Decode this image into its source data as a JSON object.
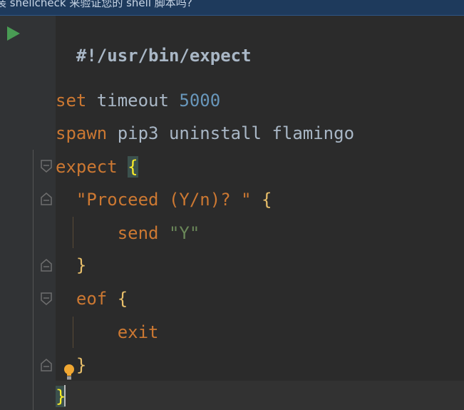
{
  "banner": {
    "text": "装 shellcheck 来验证您的 shell 脚本吗?"
  },
  "code": {
    "line1": {
      "text": "#!/usr/bin/expect"
    },
    "line3": {
      "kw": "set",
      "ident": " timeout ",
      "num": "5000"
    },
    "line4": {
      "kw": "spawn",
      "rest": " pip3 uninstall flamingo"
    },
    "line5": {
      "kw": "expect",
      "space": " ",
      "brace": "{"
    },
    "line6": {
      "indent": "  ",
      "str": "\"Proceed (Y/n)? \"",
      "space": " ",
      "brace": "{"
    },
    "line7": {
      "indent": "      ",
      "kw": "send",
      "space": " ",
      "str": "\"Y\""
    },
    "line8": {
      "indent": "  ",
      "brace": "}"
    },
    "line9": {
      "indent": "  ",
      "kw": "eof",
      "space": " ",
      "brace": "{"
    },
    "line10": {
      "indent": "      ",
      "kw": "exit"
    },
    "line11": {
      "indent": "  ",
      "brace": "}"
    },
    "line12": {
      "brace": "}"
    }
  },
  "colors": {
    "keyword": "#cc7832",
    "number": "#6897bb",
    "string": "#6a8759",
    "identifier": "#a9b7c6",
    "brace": "#e8bf6a",
    "matched_brace": "#ffef28",
    "run_icon": "#499c54",
    "bulb": "#f0a732"
  },
  "icons": {
    "run": "play-icon",
    "fold": "fold-marker-icon",
    "bulb": "lightbulb-icon"
  }
}
